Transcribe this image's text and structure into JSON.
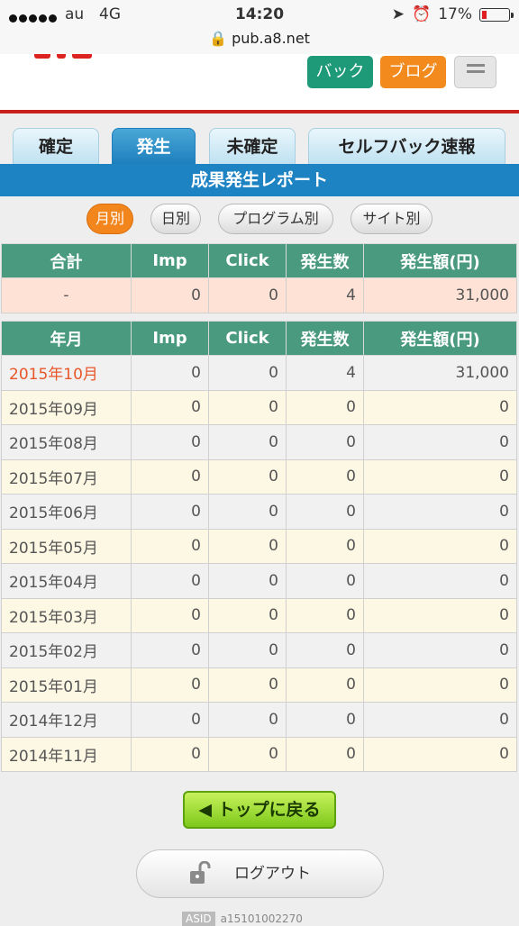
{
  "status": {
    "carrier": "au",
    "network": "4G",
    "time": "14:20",
    "battery": "17%",
    "url": "pub.a8.net"
  },
  "header": {
    "btn_back": "バック",
    "btn_blog": "ブログ",
    "menu_icon": "hamburger-icon"
  },
  "tabs": [
    {
      "label": "確定"
    },
    {
      "label": "発生"
    },
    {
      "label": "未確定"
    },
    {
      "label": "セルフバック速報"
    }
  ],
  "title": "成果発生レポート",
  "filters": [
    {
      "label": "月別"
    },
    {
      "label": "日別"
    },
    {
      "label": "プログラム別"
    },
    {
      "label": "サイト別"
    }
  ],
  "summary": {
    "headers": [
      "合計",
      "Imp",
      "Click",
      "発生数",
      "発生額(円)"
    ],
    "row": [
      "-",
      "0",
      "0",
      "4",
      "31,000"
    ]
  },
  "monthly": {
    "headers": [
      "年月",
      "Imp",
      "Click",
      "発生数",
      "発生額(円)"
    ],
    "rows": [
      [
        "2015年10月",
        "0",
        "0",
        "4",
        "31,000"
      ],
      [
        "2015年09月",
        "0",
        "0",
        "0",
        "0"
      ],
      [
        "2015年08月",
        "0",
        "0",
        "0",
        "0"
      ],
      [
        "2015年07月",
        "0",
        "0",
        "0",
        "0"
      ],
      [
        "2015年06月",
        "0",
        "0",
        "0",
        "0"
      ],
      [
        "2015年05月",
        "0",
        "0",
        "0",
        "0"
      ],
      [
        "2015年04月",
        "0",
        "0",
        "0",
        "0"
      ],
      [
        "2015年03月",
        "0",
        "0",
        "0",
        "0"
      ],
      [
        "2015年02月",
        "0",
        "0",
        "0",
        "0"
      ],
      [
        "2015年01月",
        "0",
        "0",
        "0",
        "0"
      ],
      [
        "2014年12月",
        "0",
        "0",
        "0",
        "0"
      ],
      [
        "2014年11月",
        "0",
        "0",
        "0",
        "0"
      ]
    ]
  },
  "buttons": {
    "back_to_top": "トップに戻る",
    "logout": "ログアウト"
  },
  "asid": {
    "label": "ASID",
    "value": "a15101002270"
  }
}
